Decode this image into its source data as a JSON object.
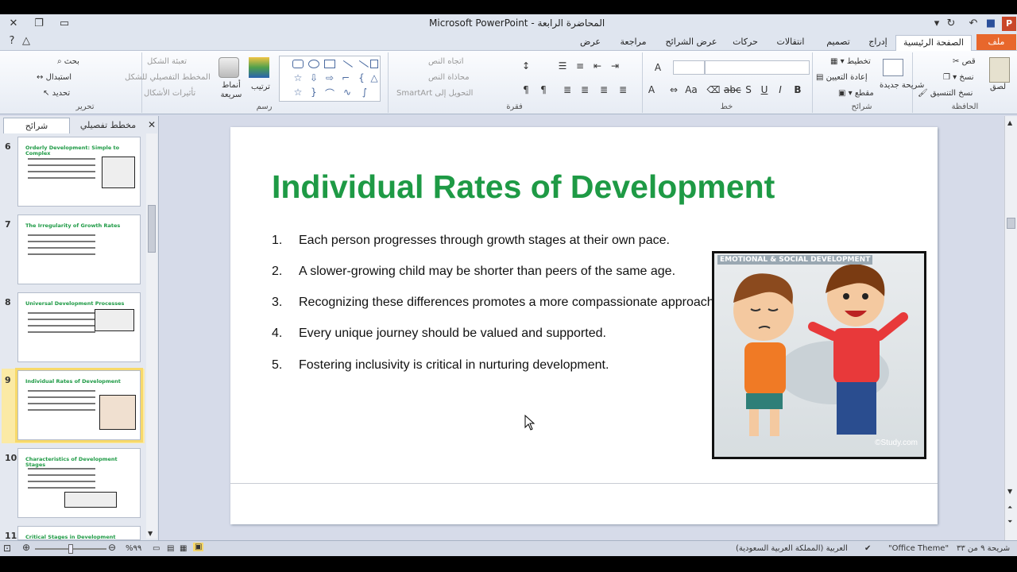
{
  "window": {
    "title": "المحاضرة الرابعة - Microsoft PowerPoint"
  },
  "tabs": {
    "file": "ملف",
    "items": [
      {
        "label": "الصفحة الرئيسية"
      },
      {
        "label": "إدراج"
      },
      {
        "label": "تصميم"
      },
      {
        "label": "انتقالات"
      },
      {
        "label": "حركات"
      },
      {
        "label": "عرض الشرائح"
      },
      {
        "label": "مراجعة"
      },
      {
        "label": "عرض"
      }
    ]
  },
  "ribbon": {
    "clipboard": {
      "label": "الحافظة",
      "paste": "لصق",
      "cut": "قص",
      "copy": "نسخ",
      "format_painter": "نسخ التنسيق"
    },
    "slides": {
      "label": "شرائح",
      "new_slide": "شريحة جديدة",
      "layout": "تخطيط",
      "reset": "إعادة التعيين",
      "section": "مقطع"
    },
    "font": {
      "label": "خط"
    },
    "paragraph": {
      "label": "فقرة",
      "text_direction": "اتجاه النص",
      "align_text": "محاذاة النص",
      "smartart": "التحويل إلى SmartArt"
    },
    "drawing": {
      "label": "رسم",
      "arrange": "ترتيب",
      "quick_styles": "أنماط سريعة",
      "shape_fill": "تعبئة الشكل",
      "shape_outline": "المخطط التفصيلي للشكل",
      "shape_effects": "تأثيرات الأشكال"
    },
    "editing": {
      "label": "تحرير",
      "find": "بحث",
      "replace": "استبدال",
      "select": "تحديد"
    }
  },
  "panel": {
    "tab_slides": "شرائح",
    "tab_outline": "مخطط تفصيلي",
    "thumbs": [
      {
        "num": "6",
        "title": "Orderly Development: Simple to Complex"
      },
      {
        "num": "7",
        "title": "The Irregularity of Growth Rates"
      },
      {
        "num": "8",
        "title": "Universal Development Processes"
      },
      {
        "num": "9",
        "title": "Individual Rates of Development"
      },
      {
        "num": "10",
        "title": "Characteristics of Development Stages"
      },
      {
        "num": "11",
        "title": "Critical Stages in Development"
      }
    ]
  },
  "slide": {
    "title": "Individual Rates of Development",
    "bullets": [
      {
        "num": "1.",
        "text": "Each person progresses through growth stages at their own pace."
      },
      {
        "num": "2.",
        "text": "A slower-growing child may be shorter than peers of the same age."
      },
      {
        "num": "3.",
        "text": "Recognizing these differences promotes a more compassionate approach."
      },
      {
        "num": "4.",
        "text": "Every unique journey should be valued and supported."
      },
      {
        "num": "5.",
        "text": "Fostering inclusivity is critical in nurturing development."
      }
    ],
    "image_caption": "EMOTIONAL & SOCIAL DEVELOPMENT",
    "image_credit": "©Study.com"
  },
  "status": {
    "slide_info": "شريحة ٩ من ٣٣",
    "theme": "\"Office Theme\"",
    "language": "العربية (المملكة العربية السعودية)",
    "zoom": "%٩٩"
  }
}
